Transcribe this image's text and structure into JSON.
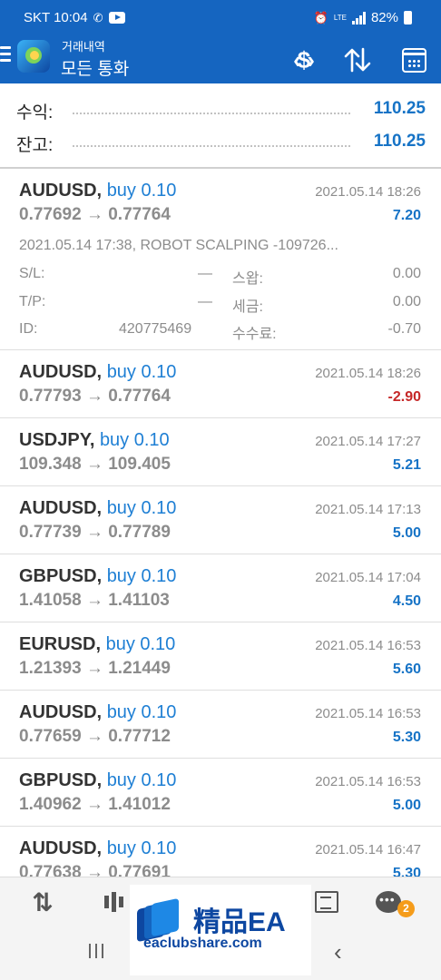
{
  "status_bar": {
    "carrier_time": "SKT 10:04",
    "lte": "LTE",
    "battery": "82%"
  },
  "app_bar": {
    "subtitle": "거래내역",
    "title": "모든 통화"
  },
  "summary": {
    "profit_label": "수익:",
    "profit_value": "110.25",
    "balance_label": "잔고:",
    "balance_value": "110.25"
  },
  "trades": [
    {
      "symbol": "AUDUSD,",
      "side": "buy 0.10",
      "prices": "0.77692 → 0.77764",
      "time": "2021.05.14 18:26",
      "profit": "7.20",
      "comment": "2021.05.14 17:38, ROBOT SCALPING -109726...",
      "details": {
        "sl_label": "S/L:",
        "sl_value": "—",
        "swap_label": "스왑:",
        "swap_value": "0.00",
        "tp_label": "T/P:",
        "tp_value": "—",
        "tax_label": "세금:",
        "tax_value": "0.00",
        "id_label": "ID:",
        "id_value": "420775469",
        "fee_label": "수수료:",
        "fee_value": "-0.70"
      }
    },
    {
      "symbol": "AUDUSD,",
      "side": "buy 0.10",
      "prices": "0.77793 → 0.77764",
      "time": "2021.05.14 18:26",
      "profit": "-2.90"
    },
    {
      "symbol": "USDJPY,",
      "side": "buy 0.10",
      "prices": "109.348 → 109.405",
      "time": "2021.05.14 17:27",
      "profit": "5.21"
    },
    {
      "symbol": "AUDUSD,",
      "side": "buy 0.10",
      "prices": "0.77739 → 0.77789",
      "time": "2021.05.14 17:13",
      "profit": "5.00"
    },
    {
      "symbol": "GBPUSD,",
      "side": "buy 0.10",
      "prices": "1.41058 → 1.41103",
      "time": "2021.05.14 17:04",
      "profit": "4.50"
    },
    {
      "symbol": "EURUSD,",
      "side": "buy 0.10",
      "prices": "1.21393 → 1.21449",
      "time": "2021.05.14 16:53",
      "profit": "5.60"
    },
    {
      "symbol": "AUDUSD,",
      "side": "buy 0.10",
      "prices": "0.77659 → 0.77712",
      "time": "2021.05.14 16:53",
      "profit": "5.30"
    },
    {
      "symbol": "GBPUSD,",
      "side": "buy 0.10",
      "prices": "1.40962 → 1.41012",
      "time": "2021.05.14 16:53",
      "profit": "5.00"
    },
    {
      "symbol": "AUDUSD,",
      "side": "buy 0.10",
      "prices": "0.77638 → 0.77691",
      "time": "2021.05.14 16:47",
      "profit": "5.30"
    }
  ],
  "bottom_nav": {
    "chat_badge": "2"
  },
  "watermark": {
    "title": "精品EA",
    "url": "eaclubshare.com"
  },
  "icons": [
    "menu-icon",
    "swap-currency-icon",
    "sort-icon",
    "calendar-icon",
    "quotes-icon",
    "chart-icon",
    "news-icon",
    "chat-icon",
    "recents-icon",
    "back-icon"
  ]
}
